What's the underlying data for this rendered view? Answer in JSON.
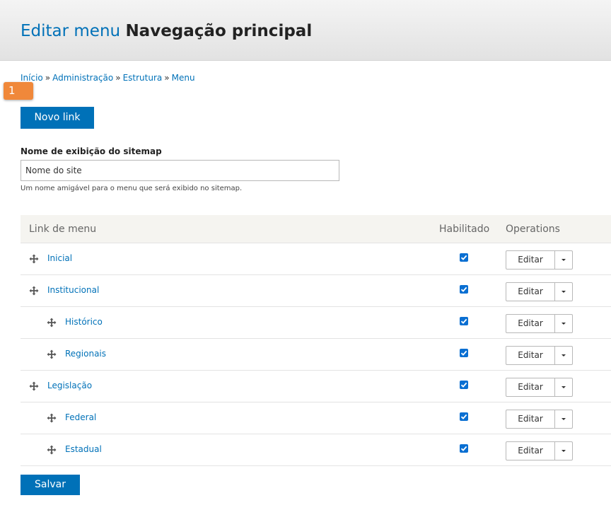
{
  "header": {
    "title_prefix": "Editar menu",
    "title_name": "Navegação principal"
  },
  "breadcrumb": [
    {
      "label": "Início"
    },
    {
      "label": "Administração"
    },
    {
      "label": "Estrutura"
    },
    {
      "label": "Menu"
    }
  ],
  "breadcrumb_separator": "»",
  "step_badge": "1",
  "actions": {
    "new_link": "Novo link",
    "save": "Salvar"
  },
  "sitemap_field": {
    "label": "Nome de exibição do sitemap",
    "value": "Nome do site",
    "description": "Um nome amigável para o menu que será exibido no sitemap."
  },
  "table": {
    "headers": {
      "link": "Link de menu",
      "enabled": "Habilitado",
      "operations": "Operations"
    },
    "rows": [
      {
        "label": "Inicial",
        "enabled": true,
        "edit": "Editar",
        "depth": 0
      },
      {
        "label": "Institucional",
        "enabled": true,
        "edit": "Editar",
        "depth": 0
      },
      {
        "label": "Histórico",
        "enabled": true,
        "edit": "Editar",
        "depth": 1
      },
      {
        "label": "Regionais",
        "enabled": true,
        "edit": "Editar",
        "depth": 1
      },
      {
        "label": "Legislação",
        "enabled": true,
        "edit": "Editar",
        "depth": 0
      },
      {
        "label": "Federal",
        "enabled": true,
        "edit": "Editar",
        "depth": 1
      },
      {
        "label": "Estadual",
        "enabled": true,
        "edit": "Editar",
        "depth": 1
      }
    ]
  },
  "colors": {
    "link": "#0071b8",
    "primary_button": "#0071b8",
    "checkbox": "#0a6fd2",
    "badge": "#f0883a"
  }
}
